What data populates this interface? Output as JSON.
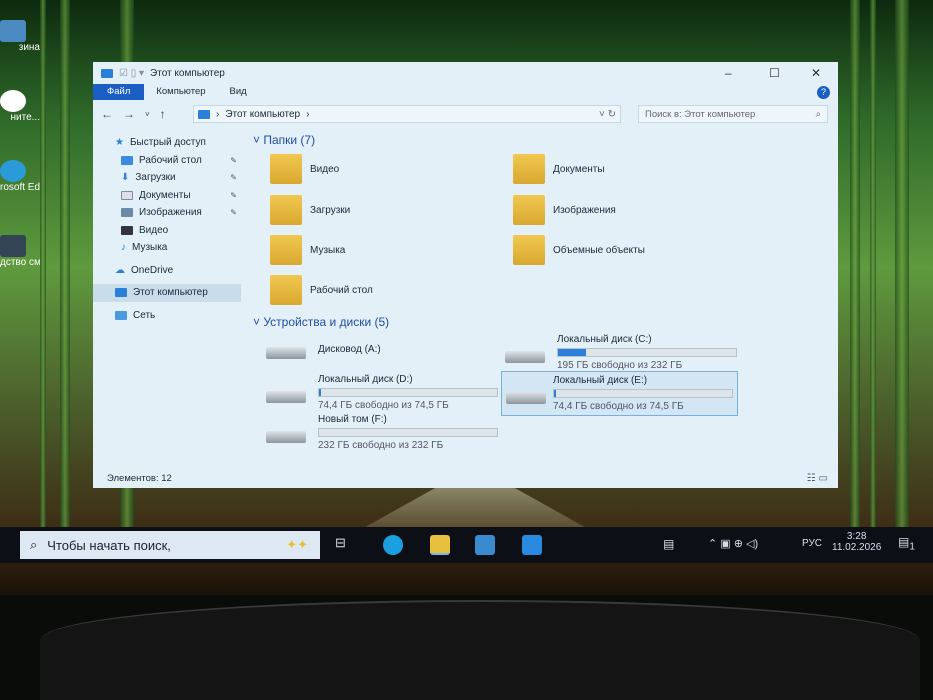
{
  "desktop": {
    "icons": [
      "зина",
      "ните...",
      "rosoft Edge",
      "дство смот..."
    ]
  },
  "window": {
    "title": "Этот компьютер",
    "ribbon": [
      "Файл",
      "Компьютер",
      "Вид"
    ],
    "path": "Этот компьютер",
    "search_placeholder": "Поиск в: Этот компьютер",
    "nav": {
      "quick": "Быстрый доступ",
      "items": [
        "Рабочий стол",
        "Загрузки",
        "Документы",
        "Изображения",
        "Видео",
        "Музыка"
      ],
      "onedrive": "OneDrive",
      "pc": "Этот компьютер",
      "net": "Сеть"
    },
    "folders_header": "Папки (7)",
    "folders": [
      "Видео",
      "Документы",
      "Загрузки",
      "Изображения",
      "Музыка",
      "Объемные объекты",
      "Рабочий стол"
    ],
    "drives_header": "Устройства и диски (5)",
    "drives": [
      {
        "name": "Дисковод (A:)"
      },
      {
        "name": "Локальный диск (C:)",
        "free": "195 ГБ свободно из 232 ГБ",
        "used": 0.16
      },
      {
        "name": "Локальный диск (D:)",
        "free": "74,4 ГБ свободно из 74,5 ГБ",
        "used": 0.01
      },
      {
        "name": "Локальный диск (E:)",
        "free": "74,4 ГБ свободно из 74,5 ГБ",
        "used": 0.01
      },
      {
        "name": "Новый том (F:)",
        "free": "232 ГБ свободно из 232 ГБ",
        "used": 0.0
      }
    ],
    "status": "Элементов: 12"
  },
  "taskbar": {
    "search": "Чтобы начать поиск,",
    "lang": "РУС",
    "time": "3:28",
    "date": "11.02.2026",
    "notif": "1"
  }
}
